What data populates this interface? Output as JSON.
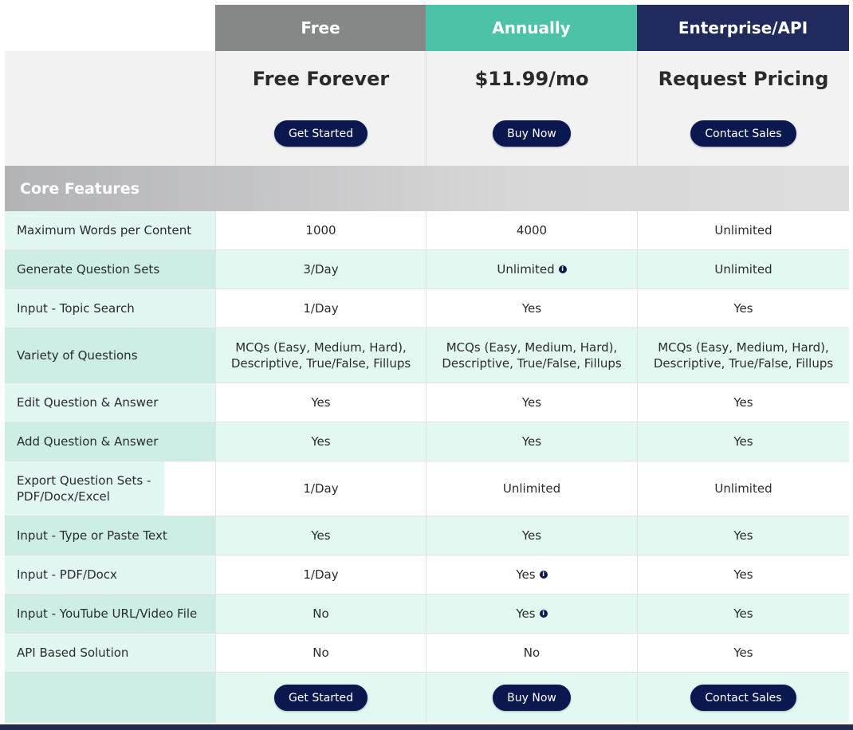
{
  "plans": {
    "free": {
      "tab": "Free",
      "title": "Free Forever",
      "button": "Get Started"
    },
    "annual": {
      "tab": "Annually",
      "title": "$11.99/mo",
      "button": "Buy Now"
    },
    "enterprise": {
      "tab": "Enterprise/API",
      "title": "Request Pricing",
      "button": "Contact Sales"
    }
  },
  "section_title": "Core Features",
  "features": [
    {
      "label": "Maximum Words per Content",
      "free": "1000",
      "annual": "4000",
      "annual_info": false,
      "enterprise": "Unlimited"
    },
    {
      "label": "Generate Question Sets",
      "free": "3/Day",
      "annual": "Unlimited",
      "annual_info": true,
      "enterprise": "Unlimited"
    },
    {
      "label": "Input - Topic Search",
      "free": "1/Day",
      "annual": "Yes",
      "annual_info": false,
      "enterprise": "Yes"
    },
    {
      "label": "Variety of Questions",
      "free": "MCQs (Easy, Medium, Hard), Descriptive, True/False, Fillups",
      "annual": "MCQs (Easy, Medium, Hard), Descriptive, True/False, Fillups",
      "annual_info": false,
      "enterprise": "MCQs (Easy, Medium, Hard), Descriptive, True/False, Fillups"
    },
    {
      "label": "Edit Question & Answer",
      "free": "Yes",
      "annual": "Yes",
      "annual_info": false,
      "enterprise": "Yes"
    },
    {
      "label": "Add Question & Answer",
      "free": "Yes",
      "annual": "Yes",
      "annual_info": false,
      "enterprise": "Yes"
    },
    {
      "label": "Export Question Sets - PDF/Docx/Excel",
      "free": "1/Day",
      "annual": "Unlimited",
      "annual_info": false,
      "enterprise": "Unlimited"
    },
    {
      "label": "Input - Type or Paste Text",
      "free": "Yes",
      "annual": "Yes",
      "annual_info": false,
      "enterprise": "Yes"
    },
    {
      "label": "Input - PDF/Docx",
      "free": "1/Day",
      "annual": "Yes",
      "annual_info": true,
      "enterprise": "Yes"
    },
    {
      "label": "Input - YouTube URL/Video File",
      "free": "No",
      "annual": "Yes",
      "annual_info": true,
      "enterprise": "Yes"
    },
    {
      "label": "API Based Solution",
      "free": "No",
      "annual": "No",
      "annual_info": false,
      "enterprise": "Yes"
    }
  ],
  "footer_buttons": {
    "free": "Get Started",
    "annual": "Buy Now",
    "enterprise": "Contact Sales"
  },
  "info_icon": "info-circle-icon",
  "colors": {
    "free_tab": "#868787",
    "annual_tab": "#4cc3a6",
    "enterprise_tab": "#212a5c",
    "button": "#0b1850"
  }
}
